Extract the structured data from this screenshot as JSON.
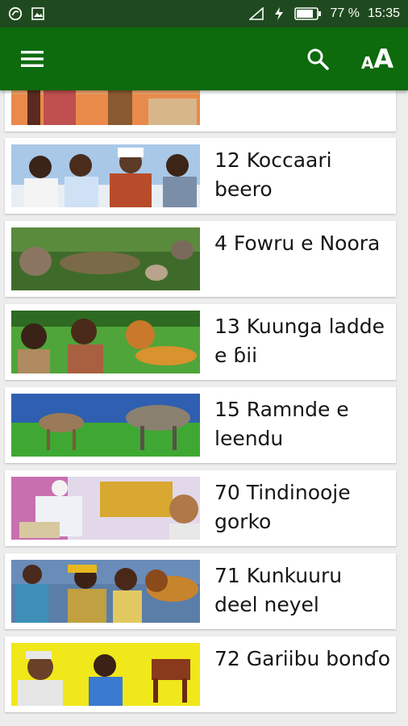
{
  "status_bar": {
    "battery": "77 %",
    "time": "15:35"
  },
  "toolbar": {
    "menu_icon": "hamburger-menu-icon",
    "search_icon": "search-icon",
    "font_size_icon": "font-size-icon",
    "font_label": "AA"
  },
  "colors": {
    "toolbar": "#0d6a0d",
    "status_bar": "#1f4a1f",
    "background": "#ededed"
  },
  "items": [
    {
      "title": ""
    },
    {
      "title": "12 Koccaari beero"
    },
    {
      "title": "4 Fowru e Noora"
    },
    {
      "title": "13 Kuunga ladde e ɓii"
    },
    {
      "title": "15 Ramnde e leendu"
    },
    {
      "title": "70 Tindinooje gorko"
    },
    {
      "title": "71 Kunkuuru deel neyel"
    },
    {
      "title": "72 Gariibu bonɗo"
    }
  ]
}
